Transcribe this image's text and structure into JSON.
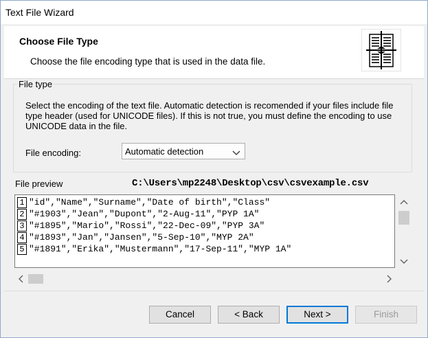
{
  "window": {
    "title": "Text File Wizard"
  },
  "header": {
    "title": "Choose File Type",
    "subtitle": "Choose the file encoding type that is used in the data file.",
    "icon": "columns-wizard-icon"
  },
  "file_type": {
    "legend": "File type",
    "description": "Select the encoding of the text file. Automatic detection is recomended if your files include file type header (used for UNICODE files). If this is not true, you must define the encoding to use UNICODE data in the file.",
    "encoding_label": "File encoding:",
    "encoding_value": "Automatic detection"
  },
  "preview": {
    "label": "File preview",
    "path": "C:\\Users\\mp2248\\Desktop\\csv\\csvexample.csv",
    "rows": [
      {
        "num": "1",
        "text": "\"id\",\"Name\",\"Surname\",\"Date of birth\",\"Class\""
      },
      {
        "num": "2",
        "text": "\"#1903\",\"Jean\",\"Dupont\",\"2-Aug-11\",\"PYP 1A\""
      },
      {
        "num": "3",
        "text": "\"#1895\",\"Mario\",\"Rossi\",\"22-Dec-09\",\"PYP 3A\""
      },
      {
        "num": "4",
        "text": "\"#1893\",\"Jan\",\"Jansen\",\"5-Sep-10\",\"MYP 2A\""
      },
      {
        "num": "5",
        "text": "\"#1891\",\"Erika\",\"Mustermann\",\"17-Sep-11\",\"MYP 1A\""
      }
    ]
  },
  "buttons": {
    "cancel": "Cancel",
    "back": "< Back",
    "next": "Next >",
    "finish": "Finish"
  },
  "colors": {
    "accent": "#0078d7",
    "window_bg": "#f0f0f0"
  }
}
